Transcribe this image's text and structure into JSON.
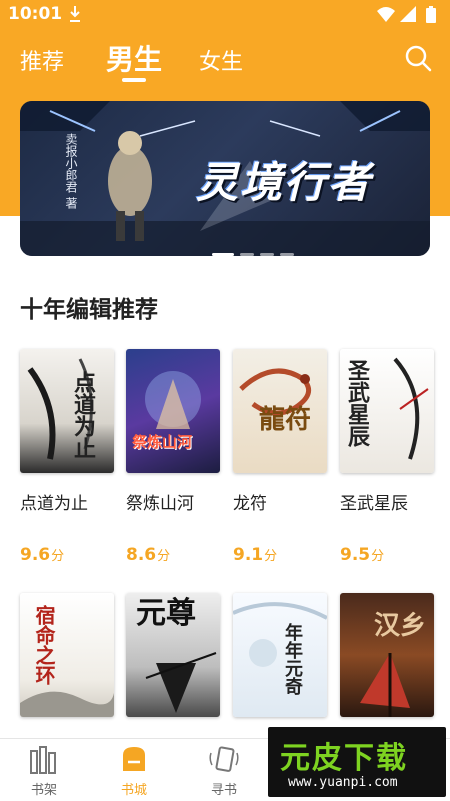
{
  "status": {
    "time": "10:01"
  },
  "tabs": [
    "推荐",
    "男生",
    "女生"
  ],
  "banner": {
    "title": "灵境行者",
    "author": "卖报小郎君 著"
  },
  "section_title": "十年编辑推荐",
  "books": [
    {
      "title": "点道为止",
      "score": "9.6",
      "unit": "分",
      "cover_text": "点道为止"
    },
    {
      "title": "祭炼山河",
      "score": "8.6",
      "unit": "分",
      "cover_text": "祭炼山河"
    },
    {
      "title": "龙符",
      "score": "9.1",
      "unit": "分",
      "cover_text": "龍符"
    },
    {
      "title": "圣武星辰",
      "score": "9.5",
      "unit": "分",
      "cover_text": "圣武星辰"
    },
    {
      "cover_text": "宿命之环"
    },
    {
      "cover_text": "元尊"
    },
    {
      "cover_text": "年年元奇"
    },
    {
      "cover_text": "汉乡"
    }
  ],
  "nav": [
    {
      "label": "书架",
      "icon": "bookshelf-icon"
    },
    {
      "label": "书城",
      "icon": "bookstore-icon"
    },
    {
      "label": "寻书",
      "icon": "find-book-icon"
    }
  ],
  "watermark": {
    "brand": "元皮下载",
    "url": "www.yuanpi.com"
  },
  "colors": {
    "accent": "#f9a825",
    "score": "#f5a623"
  }
}
